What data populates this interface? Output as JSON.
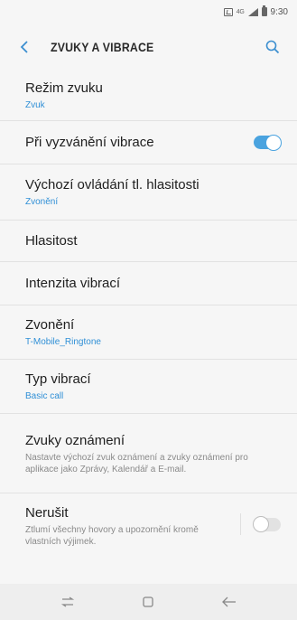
{
  "status_bar": {
    "time": "9:30",
    "network": "4G"
  },
  "app_bar": {
    "title": "ZVUKY A VIBRACE"
  },
  "items": [
    {
      "title": "Režim zvuku",
      "subtitle": "Zvuk"
    },
    {
      "title": "Při vyzvánění vibrace",
      "toggle": true
    },
    {
      "title": "Výchozí ovládání tl. hlasitosti",
      "subtitle": "Zvonění"
    },
    {
      "title": "Hlasitost"
    },
    {
      "title": "Intenzita vibrací"
    },
    {
      "title": "Zvonění",
      "subtitle": "T-Mobile_Ringtone"
    },
    {
      "title": "Typ vibrací",
      "subtitle": "Basic call"
    },
    {
      "title": "Zvuky oznámení",
      "description": "Nastavte výchozí zvuk oznámení a zvuky oznámení pro aplikace jako Zprávy, Kalendář a E-mail."
    },
    {
      "title": "Nerušit",
      "description": "Ztlumí všechny hovory a upozornění kromě vlastních výjimek.",
      "toggle": false
    }
  ],
  "colors": {
    "accent": "#4aa3df",
    "link": "#2f8fd6",
    "background": "#f6f6f6"
  },
  "icons": {
    "back": "chevron-left-icon",
    "search": "search-icon",
    "recents": "recents-icon",
    "home": "home-icon",
    "nav_back": "back-arrow-icon"
  }
}
